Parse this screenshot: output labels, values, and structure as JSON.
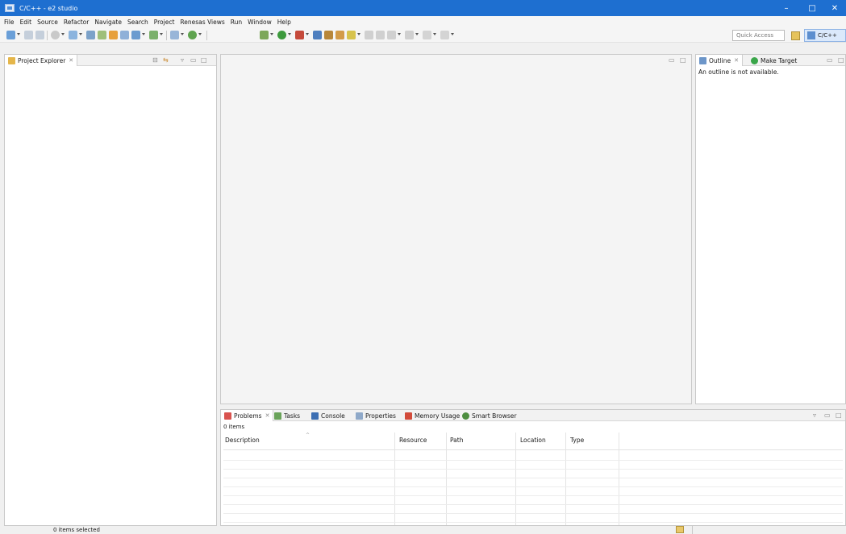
{
  "window": {
    "title": "C/C++ - e2 studio",
    "minimize": "–",
    "maximize": "□",
    "close": "✕"
  },
  "menu": [
    "File",
    "Edit",
    "Source",
    "Refactor",
    "Navigate",
    "Search",
    "Project",
    "Renesas Views",
    "Run",
    "Window",
    "Help"
  ],
  "toolbar": {
    "quick_access_placeholder": "Quick Access",
    "perspective": "C/C++"
  },
  "project_explorer": {
    "tab_label": "Project Explorer",
    "close_glyph": "✕"
  },
  "outline": {
    "tabs": [
      {
        "label": "Outline",
        "close_glyph": "✕"
      },
      {
        "label": "Make Target"
      }
    ],
    "message": "An outline is not available."
  },
  "problems": {
    "tabs": [
      {
        "label": "Problems",
        "close_glyph": "✕"
      },
      {
        "label": "Tasks"
      },
      {
        "label": "Console"
      },
      {
        "label": "Properties"
      },
      {
        "label": "Memory Usage"
      },
      {
        "label": "Smart Browser"
      }
    ],
    "count": "0 items",
    "columns": [
      "Description",
      "Resource",
      "Path",
      "Location",
      "Type"
    ]
  },
  "status": {
    "selection": "0 items selected"
  },
  "colors": {
    "titlebar": "#1e6fd0",
    "accent": "#3b7bd3"
  }
}
